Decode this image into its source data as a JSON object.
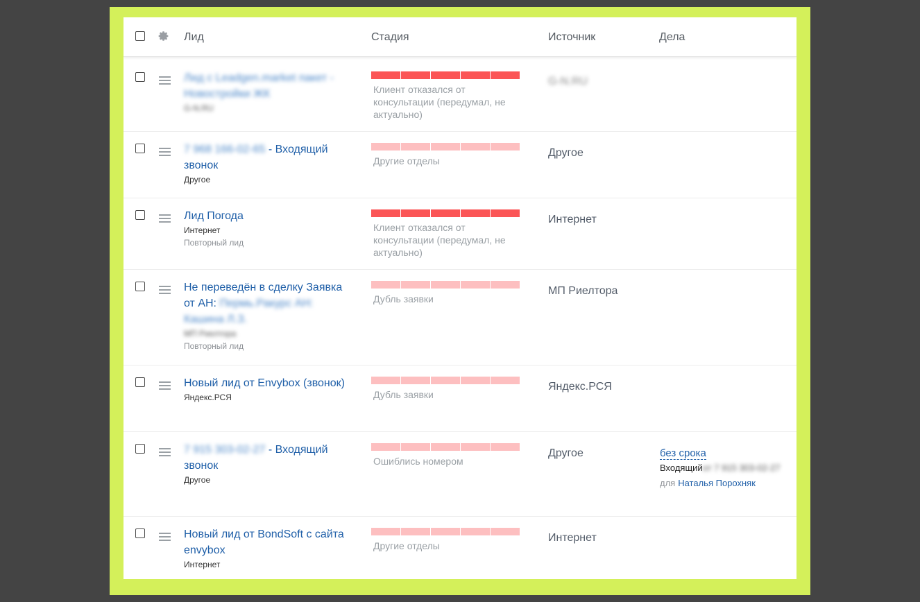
{
  "header": {
    "lead": "Лид",
    "stage": "Стадия",
    "source": "Источник",
    "tasks": "Дела"
  },
  "rows": [
    {
      "title_blur": "Лид с Leadgen.market пакет - Новостройки ЖК",
      "title": "",
      "sub_blur": "G-N.RU",
      "sub": "",
      "sub2": "",
      "stage_style": "red",
      "stage_text": "Клиент отказался от консультации (передумал, не актуально)",
      "source": "",
      "source_blur": "G-N.RU"
    },
    {
      "title_blur": "7 968 166-02-65",
      "title": " - Входящий звонок",
      "sub_blur": "",
      "sub": "Другое",
      "sub2": "",
      "stage_style": "pink",
      "stage_text": "Другие отделы",
      "source": "Другое",
      "source_blur": ""
    },
    {
      "title_blur": "",
      "title": "Лид Погода",
      "sub_blur": "",
      "sub": "Интернет",
      "sub2": "Повторный лид",
      "stage_style": "red",
      "stage_text": "Клиент отказался от консультации (передумал, не актуально)",
      "source": "Интернет",
      "source_blur": ""
    },
    {
      "title_blur": "Пермь.Ракурс АН: Кашина Л.З.",
      "title": "Не переведён в сделку Заявка от АН: ",
      "title_order": "plain-first",
      "sub_blur": "МП Риелтора",
      "sub": "",
      "sub2": "Повторный лид",
      "stage_style": "pink",
      "stage_text": "Дубль заявки",
      "source": "МП Риелтора",
      "source_blur": ""
    },
    {
      "title_blur": "",
      "title": "Новый лид от Envybox (звонок)",
      "sub_blur": "",
      "sub": "Яндекс.РСЯ",
      "sub2": "",
      "stage_style": "pink",
      "stage_text": "Дубль заявки",
      "source": "Яндекс.РСЯ",
      "source_blur": ""
    },
    {
      "title_blur": "7 915 303-02-27",
      "title": " - Входящий звонок",
      "sub_blur": "",
      "sub": "Другое",
      "sub2": "",
      "stage_style": "pink",
      "stage_text": "Ошиблись номером",
      "source": "Другое",
      "source_blur": "",
      "task": {
        "link": "без срока",
        "type": "Входящий",
        "type_blur": "от 7 915 303-02-27",
        "for_label": "для",
        "who": "Наталья Порохняк"
      }
    },
    {
      "title_blur": "",
      "title": "Новый лид от BondSoft с сайта envybox",
      "sub_blur": "",
      "sub": "Интернет",
      "sub2": "",
      "stage_style": "pink",
      "stage_text": "Другие отделы",
      "source": "Интернет",
      "source_blur": ""
    }
  ]
}
